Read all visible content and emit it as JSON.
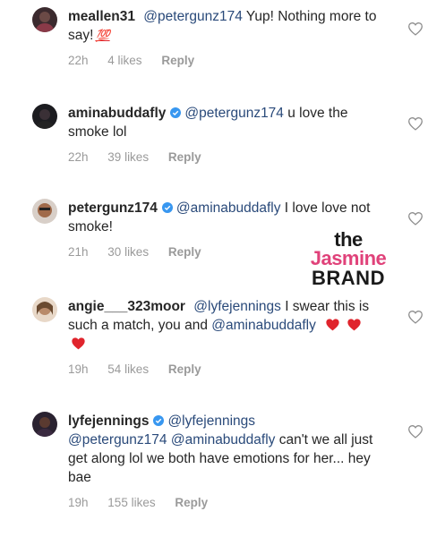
{
  "comments": [
    {
      "username": "meallen31",
      "verified": false,
      "mention": "@petergunz174",
      "text": " Yup! Nothing more to say!",
      "emoji": "💯",
      "time": "22h",
      "likes": "4 likes",
      "reply": "Reply"
    },
    {
      "username": "aminabuddafly",
      "verified": true,
      "mention": "@petergunz174",
      "text": " u love the smoke  lol",
      "time": "22h",
      "likes": "39 likes",
      "reply": "Reply"
    },
    {
      "username": "petergunz174",
      "verified": true,
      "mention": "@aminabuddafly",
      "text": " I love love not smoke!",
      "time": "21h",
      "likes": "30 likes",
      "reply": "Reply"
    },
    {
      "username": "angie___323moor",
      "verified": false,
      "mention": "@lyfejennings",
      "text": " I swear this is such a match, you and",
      "mention2": "@aminabuddafly",
      "time": "19h",
      "likes": "54 likes",
      "reply": "Reply"
    },
    {
      "username": "lyfejennings",
      "verified": true,
      "mention": "@lyfejennings",
      "mention2": "@petergunz174",
      "mention3": "@aminabuddafly",
      "text": " can't we all just get along lol we both have emotions for her... hey bae",
      "time": "19h",
      "likes": "155 likes",
      "reply": "Reply"
    }
  ],
  "watermark": {
    "the": "the",
    "jasmine": "Jasmine",
    "brand": "BRAND"
  },
  "colors": {
    "mention": "#2a4a7a",
    "meta": "#9a9a9a",
    "verified": "#3897f0",
    "heart_emoji": "#e0242c",
    "watermark_pink": "#e0427a"
  }
}
